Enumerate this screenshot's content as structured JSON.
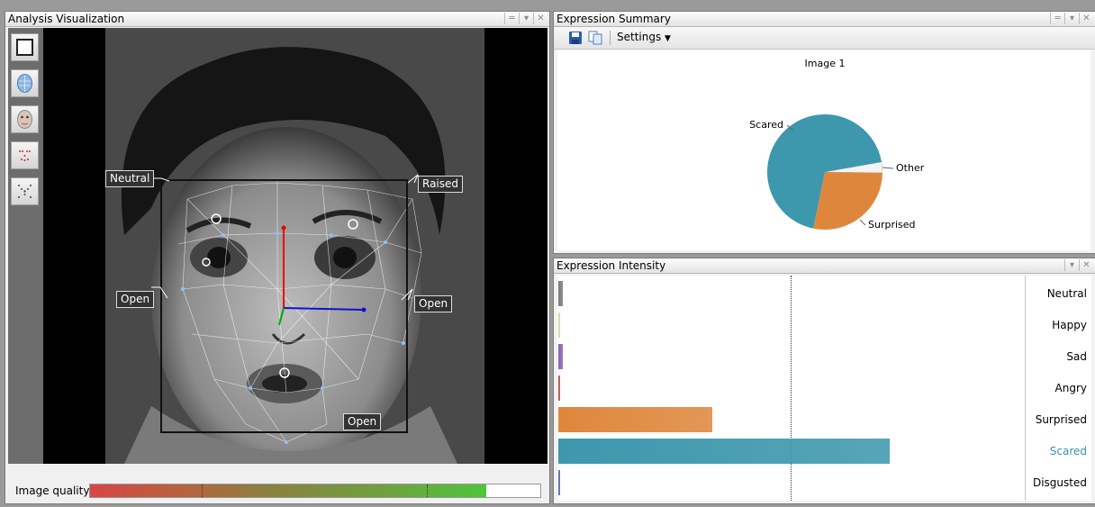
{
  "analysis": {
    "title": "Analysis Visualization",
    "tools": [
      "frame-tool-icon",
      "face-mesh-tool-icon",
      "face-texture-tool-icon",
      "points-tool-icon",
      "landmarks-tool-icon"
    ],
    "annotations": {
      "left_brow": "Neutral",
      "right_brow": "Raised",
      "left_eye": "Open",
      "right_eye": "Open",
      "mouth": "Open"
    },
    "image_quality_label": "Image quality",
    "image_quality_fraction": 0.88
  },
  "summary": {
    "title": "Expression Summary",
    "settings_label": "Settings",
    "chart_data": {
      "type": "pie",
      "title": "Image 1",
      "labels": [
        "Scared",
        "Surprised",
        "Other"
      ],
      "values": [
        69,
        28,
        3
      ],
      "colors": [
        "#3d97ad",
        "#de873c",
        "#f4f4f4"
      ]
    }
  },
  "intensity": {
    "title": "Expression Intensity",
    "highlight_color": "#3a8fb0",
    "chart_data": {
      "type": "bar",
      "orientation": "horizontal",
      "categories": [
        "Neutral",
        "Happy",
        "Sad",
        "Angry",
        "Surprised",
        "Scared",
        "Disgusted"
      ],
      "values": [
        0.01,
        0.003,
        0.01,
        0.002,
        0.33,
        0.71,
        0.003
      ],
      "colors": [
        "#7c7c7c",
        "#c6dea0",
        "#8a64ad",
        "#c05050",
        "#de873c",
        "#3d97ad",
        "#5a6ea8"
      ],
      "xlim": [
        0,
        1
      ],
      "threshold": 0.5
    }
  }
}
